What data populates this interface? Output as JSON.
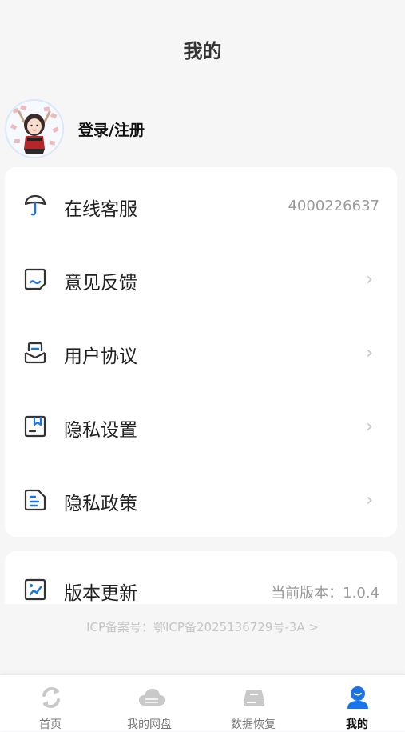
{
  "header": {
    "title": "我的"
  },
  "profile": {
    "login_label": "登录/注册"
  },
  "menu": [
    {
      "label": "在线客服",
      "value": "4000226637",
      "icon": "customer-service-icon"
    },
    {
      "label": "意见反馈",
      "value": "",
      "icon": "feedback-icon"
    },
    {
      "label": "用户协议",
      "value": "",
      "icon": "user-agreement-icon"
    },
    {
      "label": "隐私设置",
      "value": "",
      "icon": "privacy-settings-icon"
    },
    {
      "label": "隐私政策",
      "value": "",
      "icon": "privacy-policy-icon"
    }
  ],
  "update": {
    "label": "版本更新",
    "value": "当前版本：1.0.4",
    "icon": "version-update-icon"
  },
  "icp": {
    "text": "ICP备案号：鄂ICP备2025136729号-3A >"
  },
  "chevron": "›",
  "tabs": [
    {
      "label": "首页",
      "icon": "home-icon",
      "active": false
    },
    {
      "label": "我的网盘",
      "icon": "cloud-drive-icon",
      "active": false
    },
    {
      "label": "数据恢复",
      "icon": "data-recovery-icon",
      "active": false
    },
    {
      "label": "我的",
      "icon": "profile-icon",
      "active": true
    }
  ],
  "colors": {
    "accent": "#1a73e8",
    "icon_stroke": "#333333",
    "muted": "#9a9a9a"
  }
}
